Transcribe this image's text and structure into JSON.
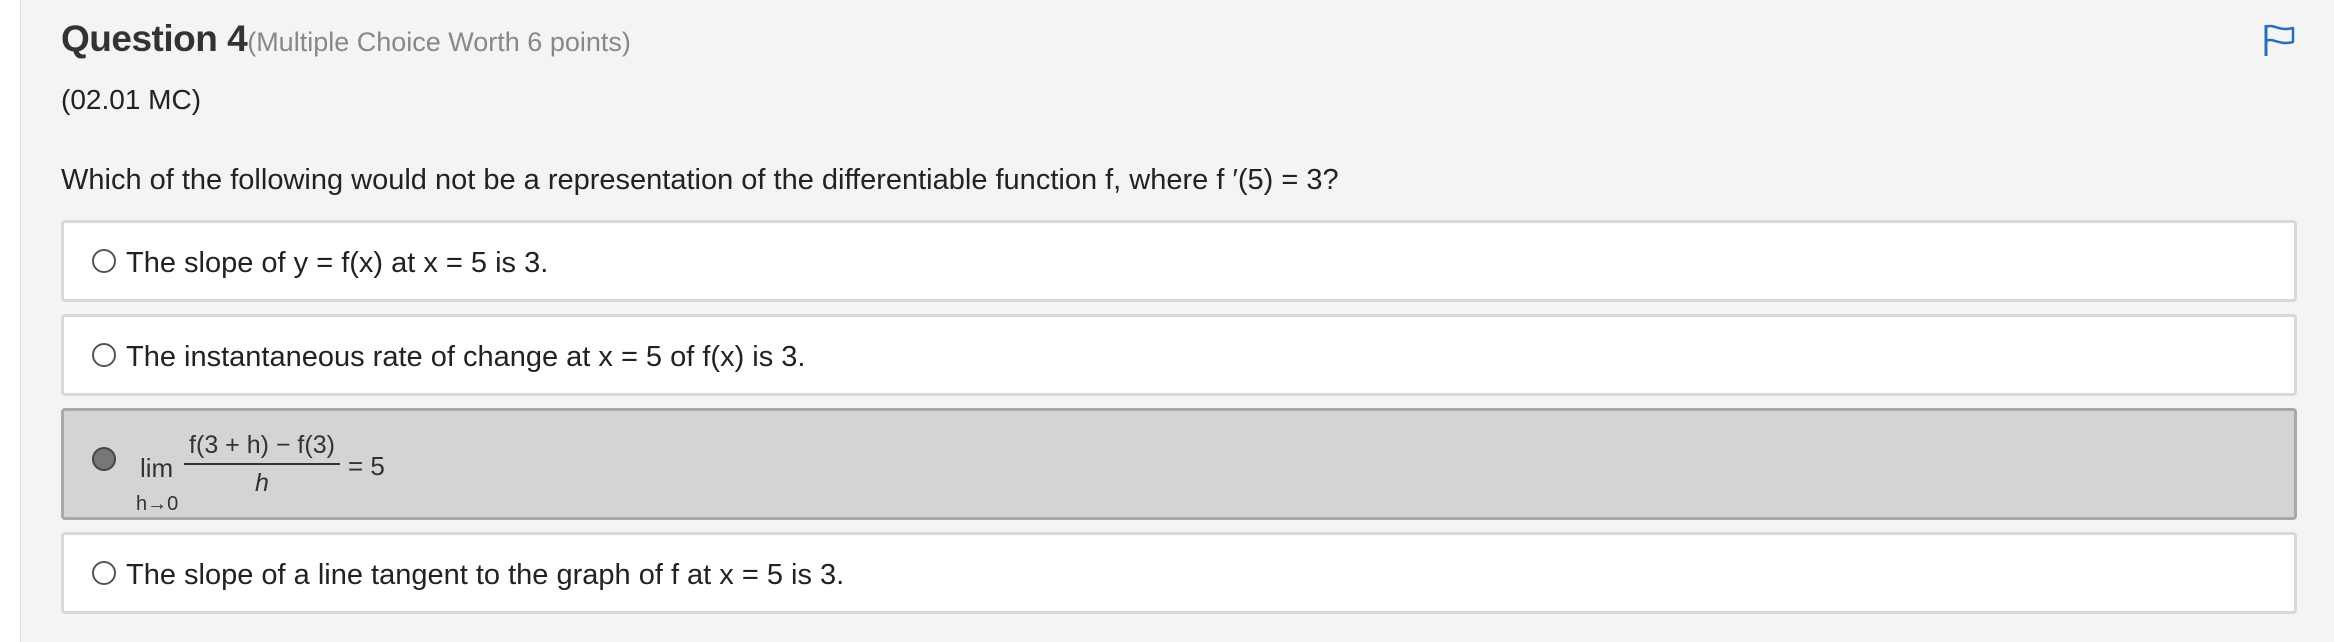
{
  "question": {
    "title": "Question 4",
    "worth": "(Multiple Choice Worth 6 points)",
    "code": "(02.01 MC)",
    "text": "Which of the following would not be a representation of the differentiable function f, where f ′(5) = 3?"
  },
  "flag_icon": "flag-icon",
  "accent_color": "#2a6ebb",
  "options": [
    {
      "label": "The slope of y = f(x) at x = 5 is 3.",
      "selected": false
    },
    {
      "label": "The instantaneous rate of change at x = 5 of f(x) is 3.",
      "selected": false
    },
    {
      "selected": true,
      "math": {
        "lim": "lim",
        "lim_sub": "h→0",
        "numerator": "f(3 + h) − f(3)",
        "denominator": "h",
        "rhs": "= 5"
      }
    },
    {
      "label": "The slope of a line tangent to the graph of f at x = 5 is 3.",
      "selected": false
    }
  ]
}
